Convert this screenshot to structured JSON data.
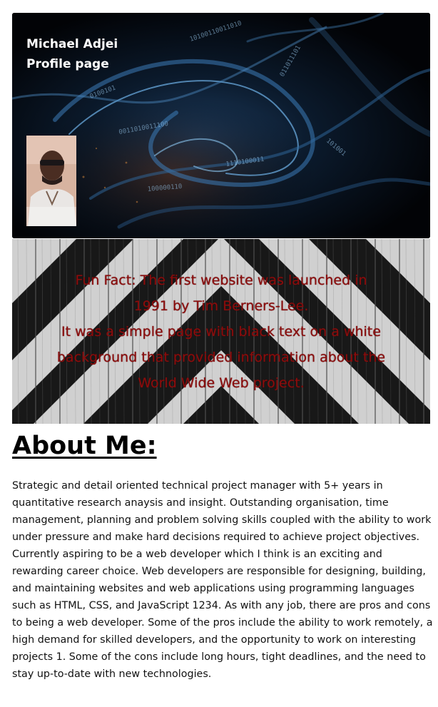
{
  "header": {
    "name": "Michael Adjei",
    "subtitle": "Profile page"
  },
  "fun_fact": {
    "line1": "Fun Fact: The first website was launched in",
    "line2": "1991 by Tim Berners-Lee.",
    "line3": "It was a simple page with black text on a white",
    "line4": "background that provided information about the",
    "line5": "World Wide Web project.",
    "text_color": "#8b0d0d"
  },
  "about": {
    "title": "About Me:",
    "paragraph1": "Strategic and detail oriented technical project manager with 5+ years in quantitative research anaysis and insight. Outstanding organisation, time management, planning and problem solving skills coupled with the ability to work under pressure and make hard decisions required to achieve project objectives.",
    "paragraph2": "Currently aspiring to be a web developer which I think is an exciting and rewarding career choice. Web developers are responsible for designing, building, and maintaining websites and web applications using programming languages such as HTML, CSS, and JavaScript 1234. As with any job, there are pros and cons to being a web developer. Some of the pros include the ability to work remotely, a high demand for skilled developers, and the opportunity to work on interesting projects 1. Some of the cons include long hours, tight deadlines, and the need to stay up-to-date with new technologies."
  }
}
